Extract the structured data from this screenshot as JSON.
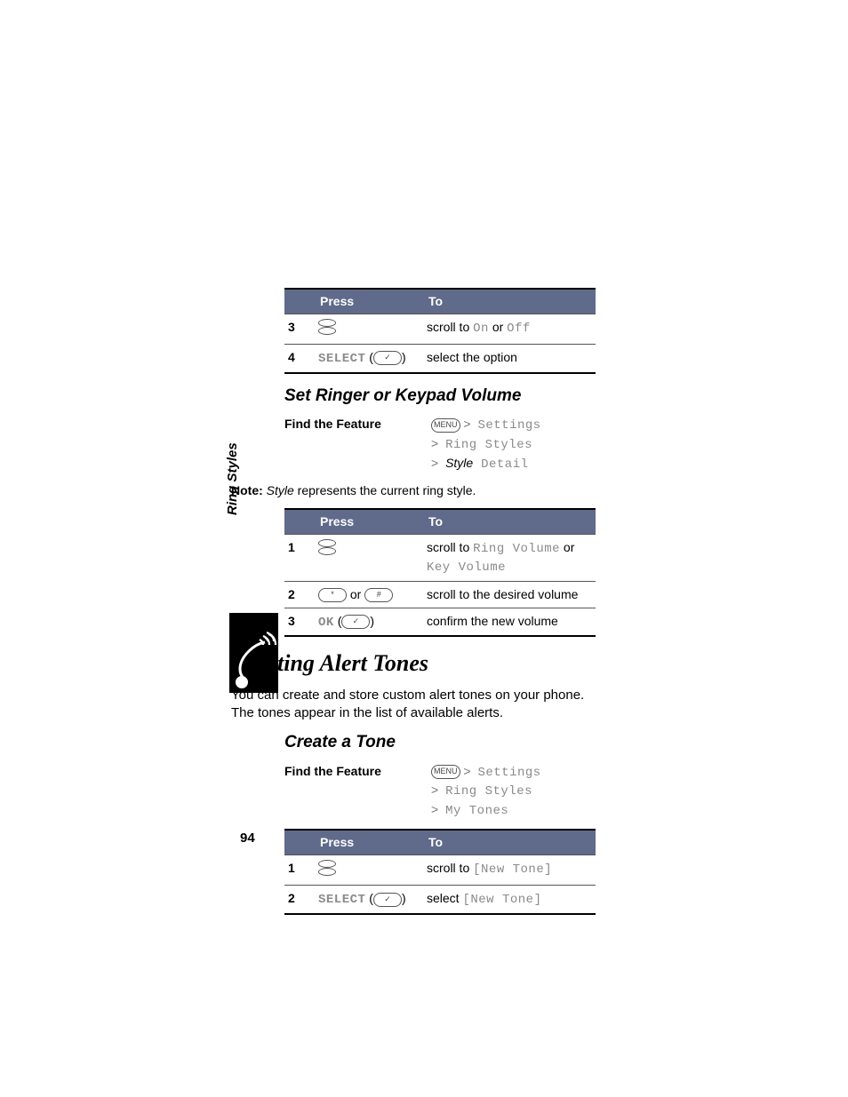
{
  "sideTab": "Ring Styles",
  "pageNumber": "94",
  "headers": {
    "press": "Press",
    "to": "To"
  },
  "keys": {
    "menu": "MENU",
    "star": "*",
    "hash": "#",
    "ok": "✓"
  },
  "labels": {
    "select": "SELECT",
    "ok": "OK",
    "or": "or",
    "findTheFeature": "Find the Feature",
    "noteLabel": "Note:"
  },
  "table1": {
    "rows": [
      {
        "num": "3",
        "press": "scroll",
        "to_pre": "scroll to ",
        "to_ui1": "On",
        "to_mid": " or ",
        "to_ui2": "Off"
      },
      {
        "num": "4",
        "press": "select",
        "to": "select the option"
      }
    ]
  },
  "section1": {
    "heading": "Set Ringer or Keypad Volume",
    "path": [
      {
        "glyph": "menu",
        "pre": " > ",
        "ui": "Settings"
      },
      {
        "pre": "> ",
        "ui": "Ring Styles"
      },
      {
        "pre": "> ",
        "italic": "Style",
        "ui": " Detail"
      }
    ],
    "noteItalic": "Style",
    "noteRest": " represents the current ring style."
  },
  "table2": {
    "rows": [
      {
        "num": "1",
        "press": "scroll",
        "to_pre": "scroll to ",
        "to_ui1": "Ring Volume",
        "to_mid": " or ",
        "to_ui2": "Key Volume"
      },
      {
        "num": "2",
        "press": "starhash",
        "to": "scroll to the desired volume"
      },
      {
        "num": "3",
        "press": "ok",
        "to": "confirm the new volume"
      }
    ]
  },
  "section2": {
    "heading": "Creating Alert Tones",
    "para": "You can create and store custom alert tones on your phone. The tones appear in the list of available alerts.",
    "subheading": "Create a Tone",
    "path": [
      {
        "glyph": "menu",
        "pre": " > ",
        "ui": "Settings"
      },
      {
        "pre": "> ",
        "ui": "Ring Styles"
      },
      {
        "pre": "> ",
        "ui": "My Tones"
      }
    ]
  },
  "table3": {
    "rows": [
      {
        "num": "1",
        "press": "scroll",
        "to_pre": "scroll to ",
        "to_ui": "[New Tone]"
      },
      {
        "num": "2",
        "press": "select",
        "to_pre": "select ",
        "to_ui": "[New Tone]"
      }
    ]
  }
}
